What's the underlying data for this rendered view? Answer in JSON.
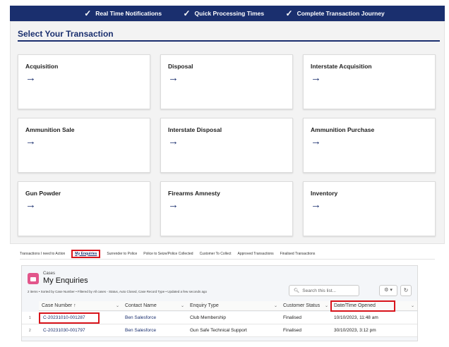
{
  "banner": {
    "items": [
      "Real Time Notifications",
      "Quick Processing Times",
      "Complete Transaction Journey"
    ]
  },
  "section": {
    "title": "Select Your Transaction"
  },
  "tiles": [
    {
      "label": "Acquisition"
    },
    {
      "label": "Disposal"
    },
    {
      "label": "Interstate Acquisition"
    },
    {
      "label": "Ammunition Sale"
    },
    {
      "label": "Interstate Disposal"
    },
    {
      "label": "Ammunition Purchase"
    },
    {
      "label": "Gun Powder"
    },
    {
      "label": "Firearms Amnesty"
    },
    {
      "label": "Inventory"
    }
  ],
  "arrow_glyph": "→",
  "tabs": [
    "Transactions I need to Action",
    "My Enquiries",
    "Surrender to Police",
    "Police to Seize/Police Collected",
    "Customer To Collect",
    "Approved Transactions",
    "Finalised Transactions"
  ],
  "active_tab": "My Enquiries",
  "cases": {
    "object_label": "Cases",
    "list_title": "My Enquiries",
    "meta": "2 items • Sorted by Case Number • Filtered by All cases - Status, Auto Closed, Case Record Type • Updated a few seconds ago",
    "search_placeholder": "Search this list...",
    "columns": [
      "Case Number ↑",
      "Contact Name",
      "Enquiry Type",
      "Customer Status",
      "Date/Time Opened"
    ],
    "rows": [
      {
        "num": "1",
        "case_number": "C-20231010-001287",
        "contact": "Ben Salesforce",
        "enquiry": "Club Membership",
        "status": "Finalised",
        "opened": "10/10/2023, 11:48 am"
      },
      {
        "num": "2",
        "case_number": "C-20231030-001797",
        "contact": "Ben Salesforce",
        "enquiry": "Gun Safe Technical Support",
        "status": "Finalised",
        "opened": "30/10/2023, 3:12 pm"
      }
    ]
  },
  "colors": {
    "brand_navy": "#1a2f6e",
    "highlight_red": "#d8141b",
    "cases_icon": "#e2568b"
  },
  "icons": {
    "check": "check-icon",
    "arrow": "arrow-right-icon",
    "search": "search-icon",
    "gear": "gear-icon",
    "refresh": "refresh-icon",
    "chevron": "chevron-down-icon"
  }
}
